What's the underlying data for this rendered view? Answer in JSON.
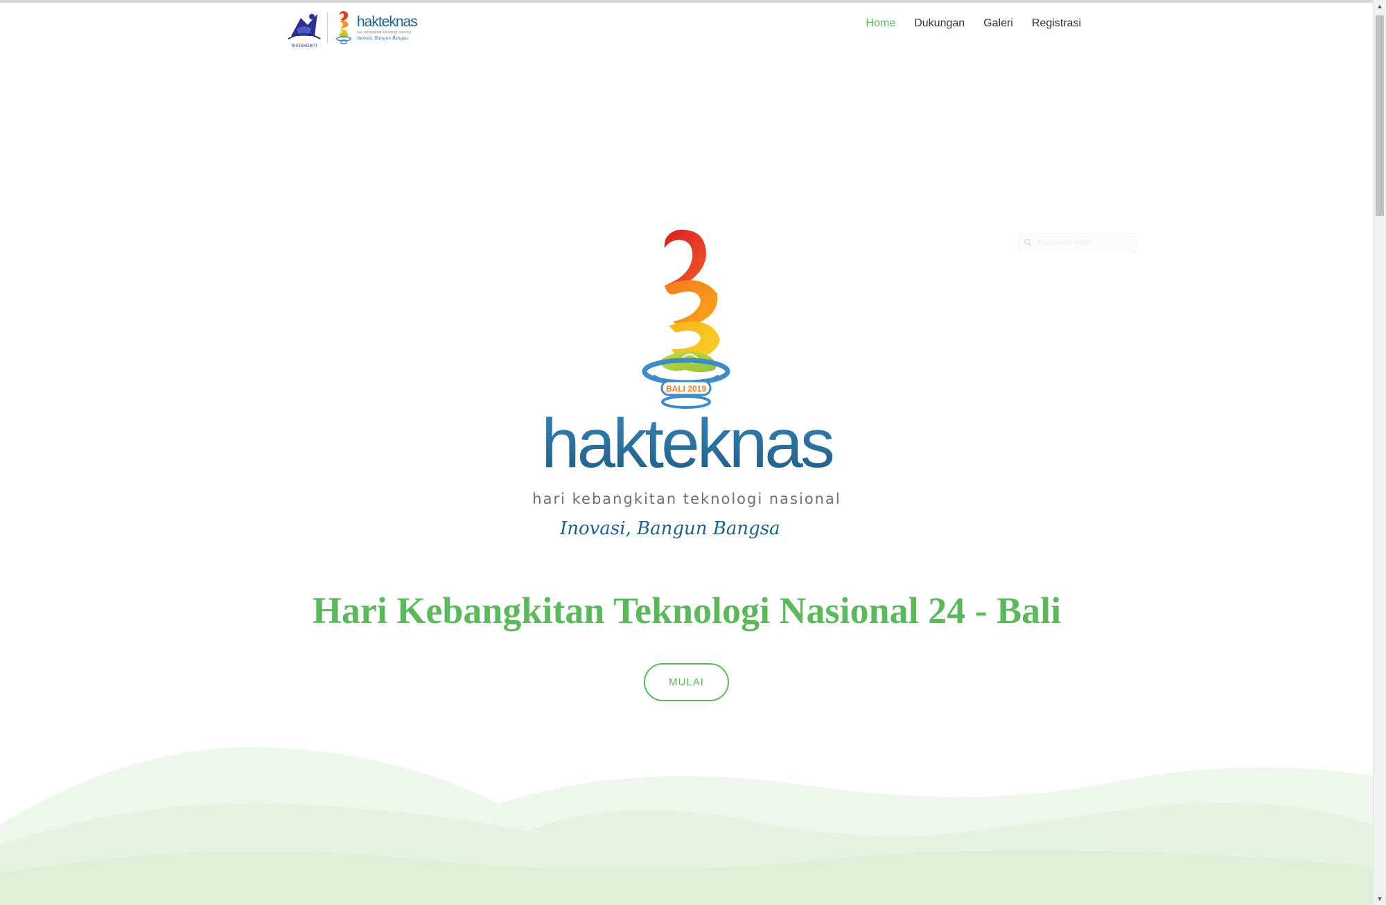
{
  "header": {
    "ristek_label": "RISTEKDIKTI",
    "mini_logo_word": "hakteknas",
    "mini_logo_sub": "hari kebangkitan teknologi nasional",
    "mini_logo_tag": "Inovasi, Bangun Bangsa"
  },
  "nav": {
    "items": [
      {
        "label": "Home",
        "active": true
      },
      {
        "label": "Dukungan",
        "active": false
      },
      {
        "label": "Galeri",
        "active": false
      },
      {
        "label": "Registrasi",
        "active": false
      }
    ]
  },
  "search": {
    "placeholder": "Pencarian situs"
  },
  "hero": {
    "emblem_label": "BALI 2019",
    "brand_word": "hakteknas",
    "brand_sub": "hari kebangkitan teknologi nasional",
    "brand_tag": "Inovasi, Bangun Bangsa",
    "title": "Hari Kebangkitan Teknologi Nasional 24 - Bali",
    "button_label": "MULAI"
  },
  "colors": {
    "accent_green": "#5cb85c",
    "brand_blue": "#2a6a93",
    "hill_light": "#eef7ec",
    "hill_mid": "#e2f1de"
  }
}
